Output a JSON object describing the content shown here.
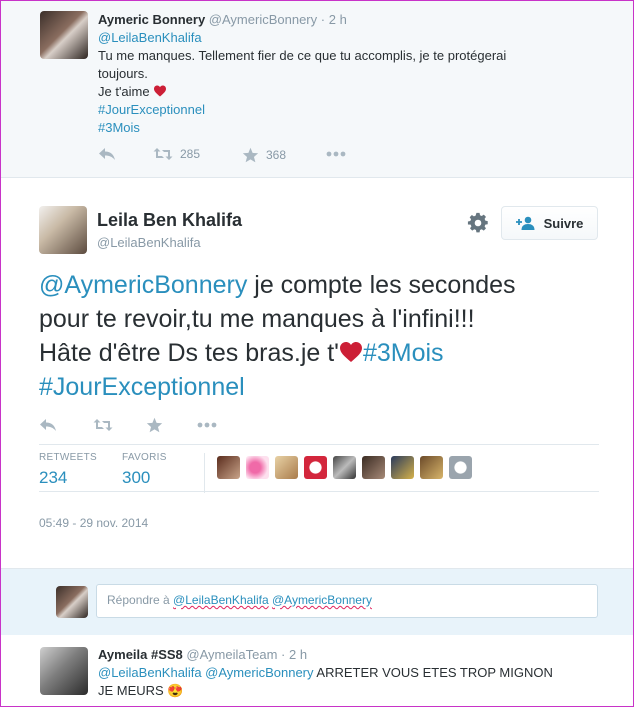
{
  "tweet1": {
    "name": "Aymeric Bonnery",
    "handle": "@AymericBonnery",
    "sep": "·",
    "time": "2 h",
    "mention": "@LeilaBenKhalifa",
    "line1": "Tu me manques. Tellement fier de ce que tu accomplis, je te protégerai",
    "line2": "toujours.",
    "line3": "Je t'aime",
    "hashtag1": "#JourExceptionnel",
    "hashtag2": "#3Mois",
    "retweets": "285",
    "favorites": "368"
  },
  "main_tweet": {
    "name": "Leila Ben Khalifa",
    "handle": "@LeilaBenKhalifa",
    "follow_label": "Suivre",
    "mention": "@AymericBonnery",
    "line1_rest": " je compte les secondes",
    "line2": "pour te revoir,tu me manques à l'infini!!!",
    "line3_text": "Hâte d'être Ds tes bras.je t'",
    "hashtag1": "#3Mois",
    "hashtag2": "#JourExceptionnel",
    "retweets_label": "RETWEETS",
    "retweets_value": "234",
    "favorites_label": "FAVORIS",
    "favorites_value": "300",
    "timestamp": "05:49 - 29 nov. 2014"
  },
  "reply": {
    "prefix": "Répondre à ",
    "mention1": "@LeilaBenKhalifa",
    "mention2": "@AymericBonnery"
  },
  "tweet3": {
    "name": "Aymeila #SS8",
    "handle": "@AymeilaTeam",
    "sep": "·",
    "time": "2 h",
    "mention1": "@LeilaBenKhalifa",
    "mention2": "@AymericBonnery",
    "text1": " ARRETER VOUS ETES TROP MIGNON",
    "text2": "JE MEURS",
    "emoji": "😍"
  },
  "colors": {
    "link": "#2a8fbd",
    "heart": "#cc1f36",
    "frame_border": "#c833c8",
    "reply_bg": "#e8f3fa"
  },
  "icons": [
    "reply-icon",
    "retweet-icon",
    "star-icon",
    "more-icon",
    "gear-icon",
    "add-user-icon",
    "heart-icon"
  ]
}
